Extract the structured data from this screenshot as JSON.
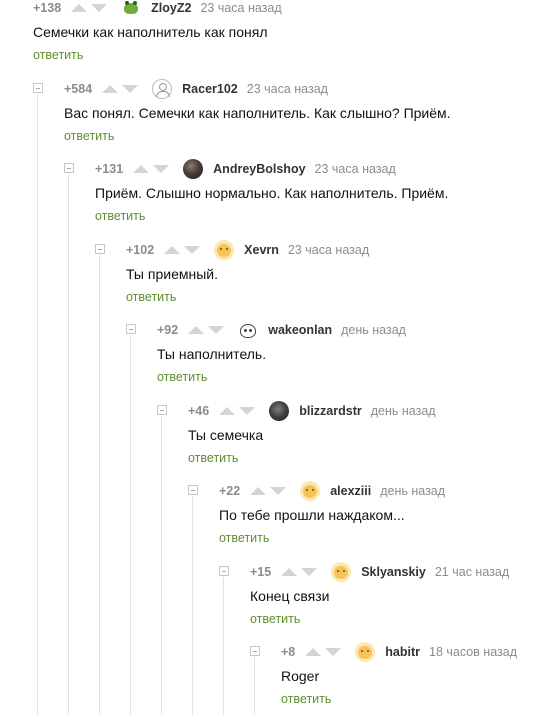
{
  "reply_label": "ответить",
  "comments": [
    {
      "rating": "+138",
      "username": "ZloyZ2",
      "time": "23 часа назад",
      "text": "Семечки как наполнитель как понял",
      "avatar": "frog-icon"
    },
    {
      "rating": "+584",
      "username": "Racer102",
      "time": "23 часа назад",
      "text": "Вас понял. Семечки как наполнитель. Как слышно? Приём.",
      "avatar": "default-user-icon"
    },
    {
      "rating": "+131",
      "username": "AndreyBolshoy",
      "time": "23 часа назад",
      "text": "Приём. Слышно нормально. Как наполнитель. Приём.",
      "avatar": "user-photo"
    },
    {
      "rating": "+102",
      "username": "Xevrn",
      "time": "23 часа назад",
      "text": "Ты приемный.",
      "avatar": "pikabu-icon"
    },
    {
      "rating": "+92",
      "username": "wakeonlan",
      "time": "день назад",
      "text": "Ты наполнитель.",
      "avatar": "sketch-face-icon"
    },
    {
      "rating": "+46",
      "username": "blizzardstr",
      "time": "день назад",
      "text": "Ты семечка",
      "avatar": "user-photo"
    },
    {
      "rating": "+22",
      "username": "alexziii",
      "time": "день назад",
      "text": "По тебе прошли наждаком...",
      "avatar": "pikabu-icon"
    },
    {
      "rating": "+15",
      "username": "Sklyanskiy",
      "time": "21 час назад",
      "text": "Конец связи",
      "avatar": "pikabu-icon"
    },
    {
      "rating": "+8",
      "username": "habitr",
      "time": "18 часов назад",
      "text": "Roger",
      "avatar": "pikabu-icon"
    }
  ],
  "colors": {
    "reply_link": "#5f8f2f",
    "rating": "#8c8c8c",
    "thread_line": "#e2e2e2"
  }
}
